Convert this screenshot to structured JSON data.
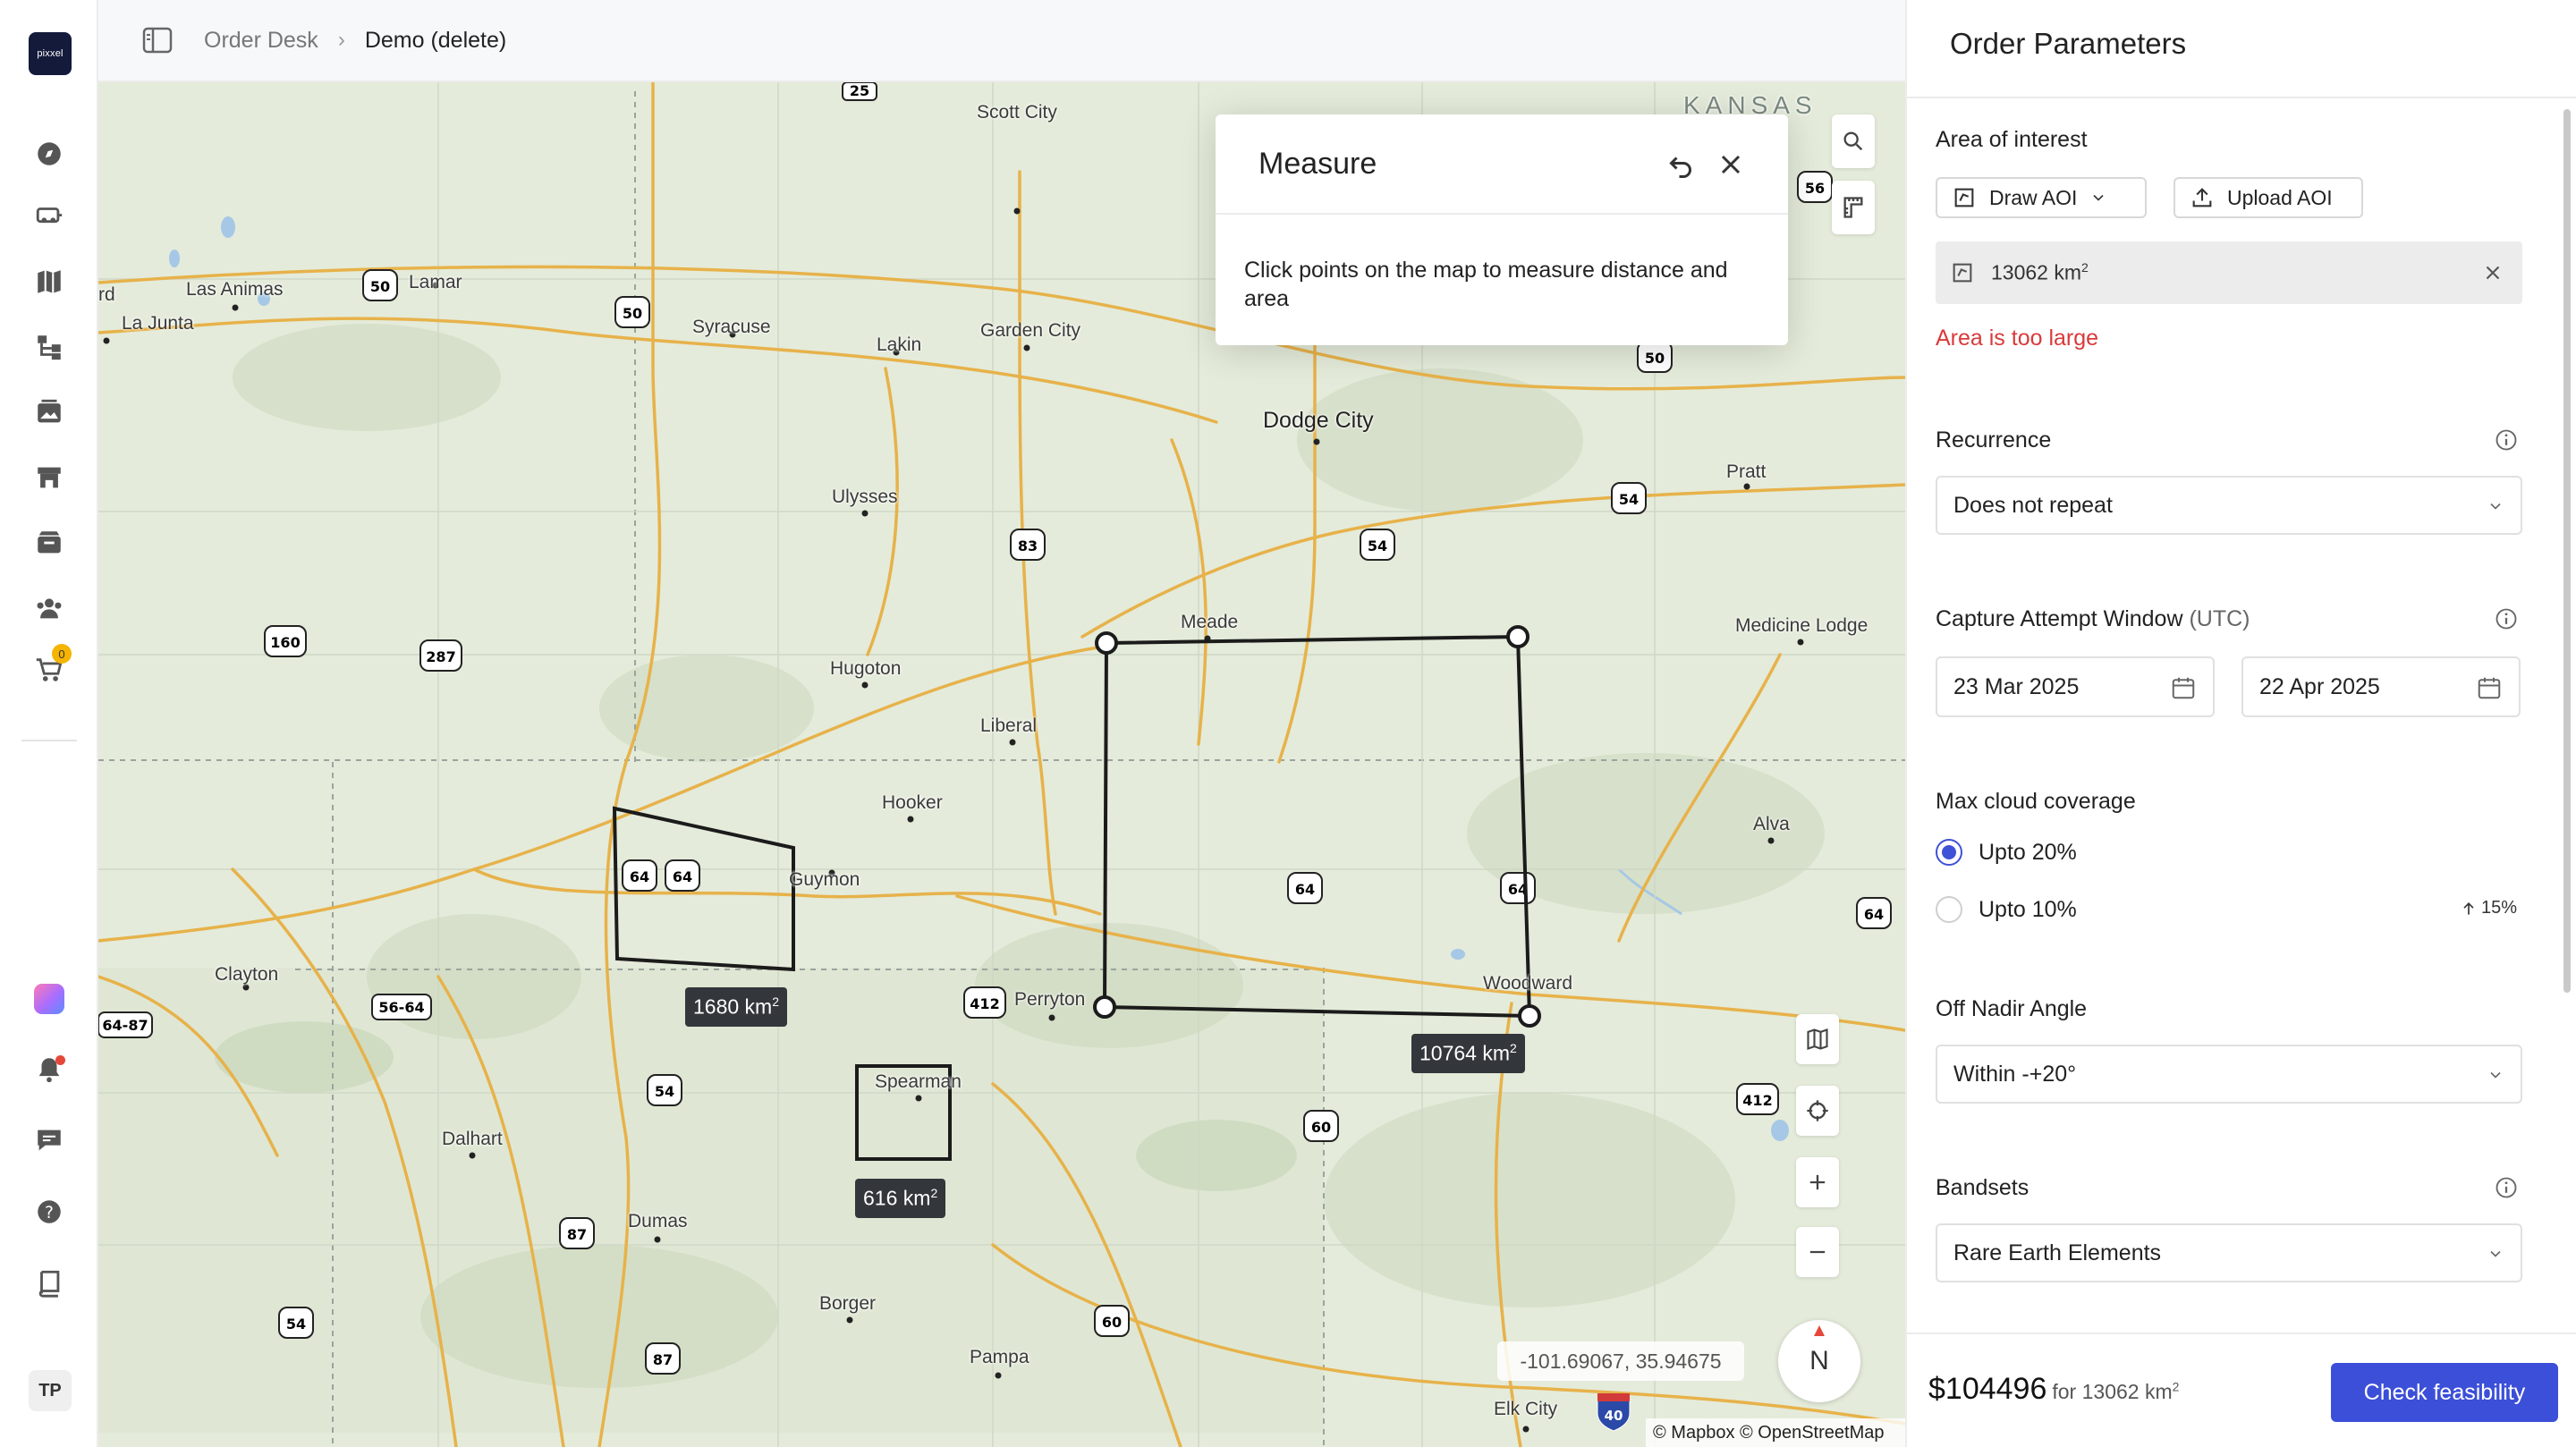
{
  "app": {
    "logo_text": "pixxel",
    "user_initials": "TP",
    "cart_count": "0"
  },
  "breadcrumb": {
    "parent": "Order Desk",
    "current": "Demo (delete)"
  },
  "rail_icons": [
    "compass-icon",
    "vehicle-icon",
    "map-icon",
    "workflow-icon",
    "gallery-icon",
    "store-icon",
    "archive-icon",
    "team-icon",
    "cart-icon",
    "apps-icon",
    "bell-icon",
    "chat-icon",
    "help-icon",
    "book-icon"
  ],
  "map": {
    "state_label": "KANSAS",
    "places": [
      "Scott City",
      "Las Animas",
      "Lamar",
      "La Junta",
      "Syracuse",
      "Garden City",
      "Lakin",
      "Dodge City",
      "Ulysses",
      "Pratt",
      "Meade",
      "Medicine Lodge",
      "Hugoton",
      "Liberal",
      "Hooker",
      "Guymon",
      "Alva",
      "Clayton",
      "Perryton",
      "Woodward",
      "Spearman",
      "Dalhart",
      "Dumas",
      "Borger",
      "Pampa",
      "Elk City",
      "rd"
    ],
    "shields": [
      "25",
      "56",
      "50",
      "50",
      "50",
      "83",
      "54",
      "54",
      "160",
      "287",
      "64",
      "64",
      "64",
      "64",
      "56-64",
      "412",
      "64-87",
      "54",
      "412",
      "60",
      "87",
      "54",
      "87",
      "60",
      "40",
      "64"
    ],
    "area_labels": {
      "a": "1680 km",
      "b": "10764 km",
      "c": "616 km",
      "unit_sup": "2"
    },
    "coord_readout": "-101.69067, 35.94675",
    "attribution": "© Mapbox © OpenStreetMap",
    "compass_label": "N"
  },
  "measure": {
    "title": "Measure",
    "body": "Click points on the map to measure distance and area"
  },
  "panel": {
    "title": "Order Parameters",
    "aoi": {
      "label": "Area of interest",
      "draw_label": "Draw AOI",
      "upload_label": "Upload AOI",
      "area_value": "13062 km",
      "unit_sup": "2",
      "error": "Area is too large"
    },
    "recurrence": {
      "label": "Recurrence",
      "value": "Does not repeat"
    },
    "capture": {
      "label": "Capture Attempt Window",
      "label_suffix": "(UTC)",
      "start": "23 Mar 2025",
      "end": "22 Apr 2025"
    },
    "cloud": {
      "label": "Max cloud coverage",
      "options": [
        "Upto 20%",
        "Upto 10%"
      ],
      "selected": 0,
      "delta": "15%"
    },
    "nadir": {
      "label": "Off Nadir Angle",
      "value": "Within -+20°"
    },
    "bandsets": {
      "label": "Bandsets",
      "value": "Rare Earth Elements"
    },
    "footer": {
      "price": "$104496",
      "price_for": "for 13062 km",
      "unit_sup": "2",
      "cta": "Check feasibility"
    }
  },
  "colors": {
    "accent": "#3c4fd8",
    "error": "#d93a3a",
    "map_bg": "#e4ebda",
    "road": "#e7b24a"
  }
}
